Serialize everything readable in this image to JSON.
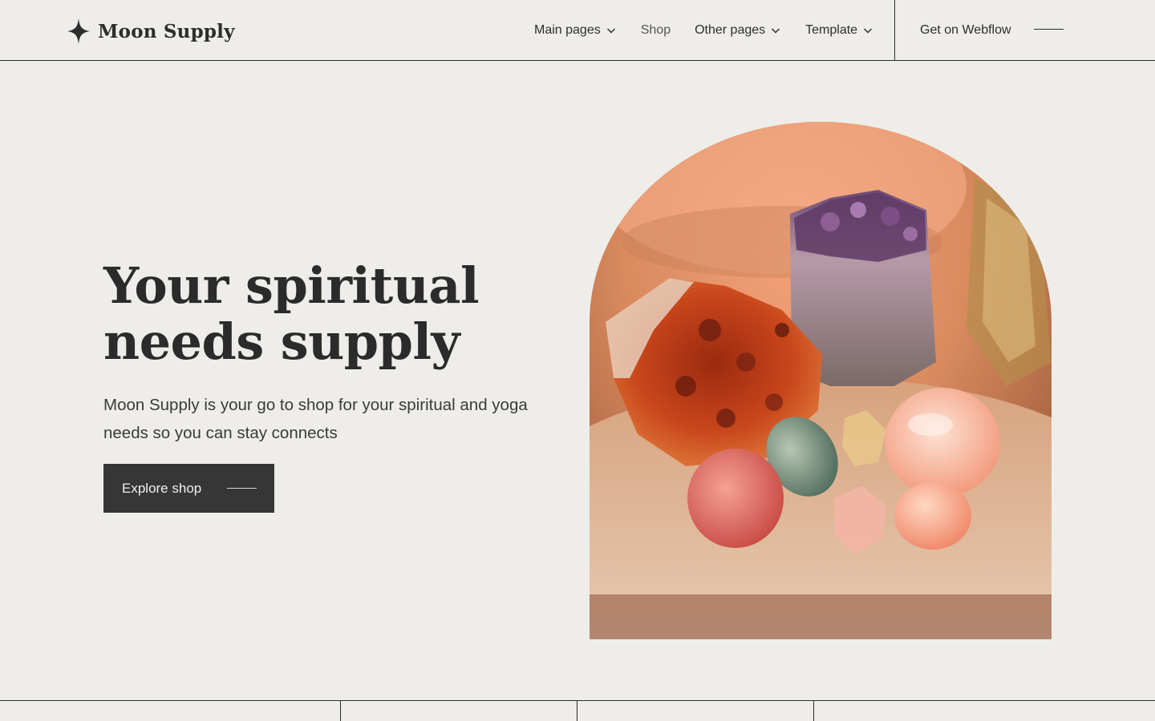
{
  "brand": {
    "name": "Moon Supply",
    "icon": "four-point-star-icon"
  },
  "nav": {
    "items": [
      {
        "label": "Main pages",
        "has_dropdown": true
      },
      {
        "label": "Shop",
        "has_dropdown": false
      },
      {
        "label": "Other pages",
        "has_dropdown": true
      },
      {
        "label": "Template",
        "has_dropdown": true
      }
    ],
    "cta_label": "Get on Webflow",
    "menu_icon": "menu-line-icon"
  },
  "hero": {
    "title_line1": "Your spiritual",
    "title_line2": "needs supply",
    "description": "Moon Supply is your go to shop for your spiritual and yoga needs so you can stay connects",
    "button_label": "Explore shop",
    "image_subject": "crystals-and-gemstones-photo"
  },
  "colors": {
    "background": "#efede9",
    "text": "#2d2d2d",
    "button": "#363636",
    "button_text": "#f2f0ec"
  }
}
